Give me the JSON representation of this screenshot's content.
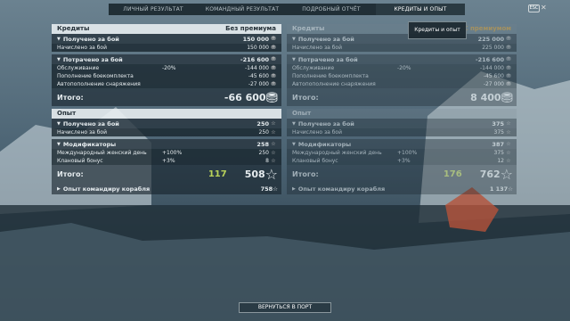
{
  "tabs": [
    "ЛИЧНЫЙ РЕЗУЛЬТАТ",
    "КОМАНДНЫЙ РЕЗУЛЬТАТ",
    "ПОДРОБНЫЙ ОТЧЁТ",
    "КРЕДИТЫ И ОПЫТ"
  ],
  "esc_label": "ESC",
  "tooltip": "Кредиты и опыт",
  "left": {
    "credits_title": "Кредиты",
    "credits_header_right": "Без премиума",
    "earned_label": "Получено за бой",
    "earned_val": "150 000",
    "accrued_label": "Начислено за бой",
    "accrued_val": "150 000",
    "spent_label": "Потрачено за бой",
    "spent_val": "-216 600",
    "service_label": "Обслуживание",
    "service_pct": "-20%",
    "service_val": "-144 000",
    "ammo_label": "Пополнение боекомплекта",
    "ammo_val": "-45 600",
    "auto_label": "Автопополнение снаряжения",
    "auto_val": "-27 000",
    "total_label": "Итого:",
    "total_val": "-66 600",
    "exp_title": "Опыт",
    "exp_earned_label": "Получено за бой",
    "exp_earned_val": "250",
    "exp_accrued_label": "Начислено за бой",
    "exp_accrued_val": "250",
    "mods_label": "Модификаторы",
    "mods_val": "258",
    "women_label": "Международный женский день",
    "women_pct": "+100%",
    "women_val": "250",
    "clan_label": "Клановый бонус",
    "clan_pct": "+3%",
    "clan_val": "8",
    "exp_total_label": "Итого:",
    "exp_total_gold": "117",
    "exp_total_val": "508",
    "cmd_label": "Опыт командиру корабля",
    "cmd_val": "758"
  },
  "right": {
    "credits_title": "Кредиты",
    "credits_header_right": "С премиумом",
    "earned_label": "Получено за бой",
    "earned_val": "225 000",
    "accrued_label": "Начислено за бой",
    "accrued_val": "225 000",
    "spent_label": "Потрачено за бой",
    "spent_val": "-216 600",
    "service_label": "Обслуживание",
    "service_pct": "-20%",
    "service_val": "-144 000",
    "ammo_label": "Пополнение боекомплекта",
    "ammo_val": "-45 600",
    "auto_label": "Автопополнение снаряжения",
    "auto_val": "-27 000",
    "total_label": "Итого:",
    "total_val": "8 400",
    "exp_title": "Опыт",
    "exp_earned_label": "Получено за бой",
    "exp_earned_val": "375",
    "exp_accrued_label": "Начислено за бой",
    "exp_accrued_val": "375",
    "mods_label": "Модификаторы",
    "mods_val": "387",
    "women_label": "Международный женский день",
    "women_pct": "+100%",
    "women_val": "375",
    "clan_label": "Клановый бонус",
    "clan_pct": "+3%",
    "clan_val": "12",
    "exp_total_label": "Итого:",
    "exp_total_gold": "176",
    "exp_total_val": "762",
    "cmd_label": "Опыт командиру корабля",
    "cmd_val": "1 137"
  },
  "back_label": "ВЕРНУТЬСЯ В ПОРТ"
}
